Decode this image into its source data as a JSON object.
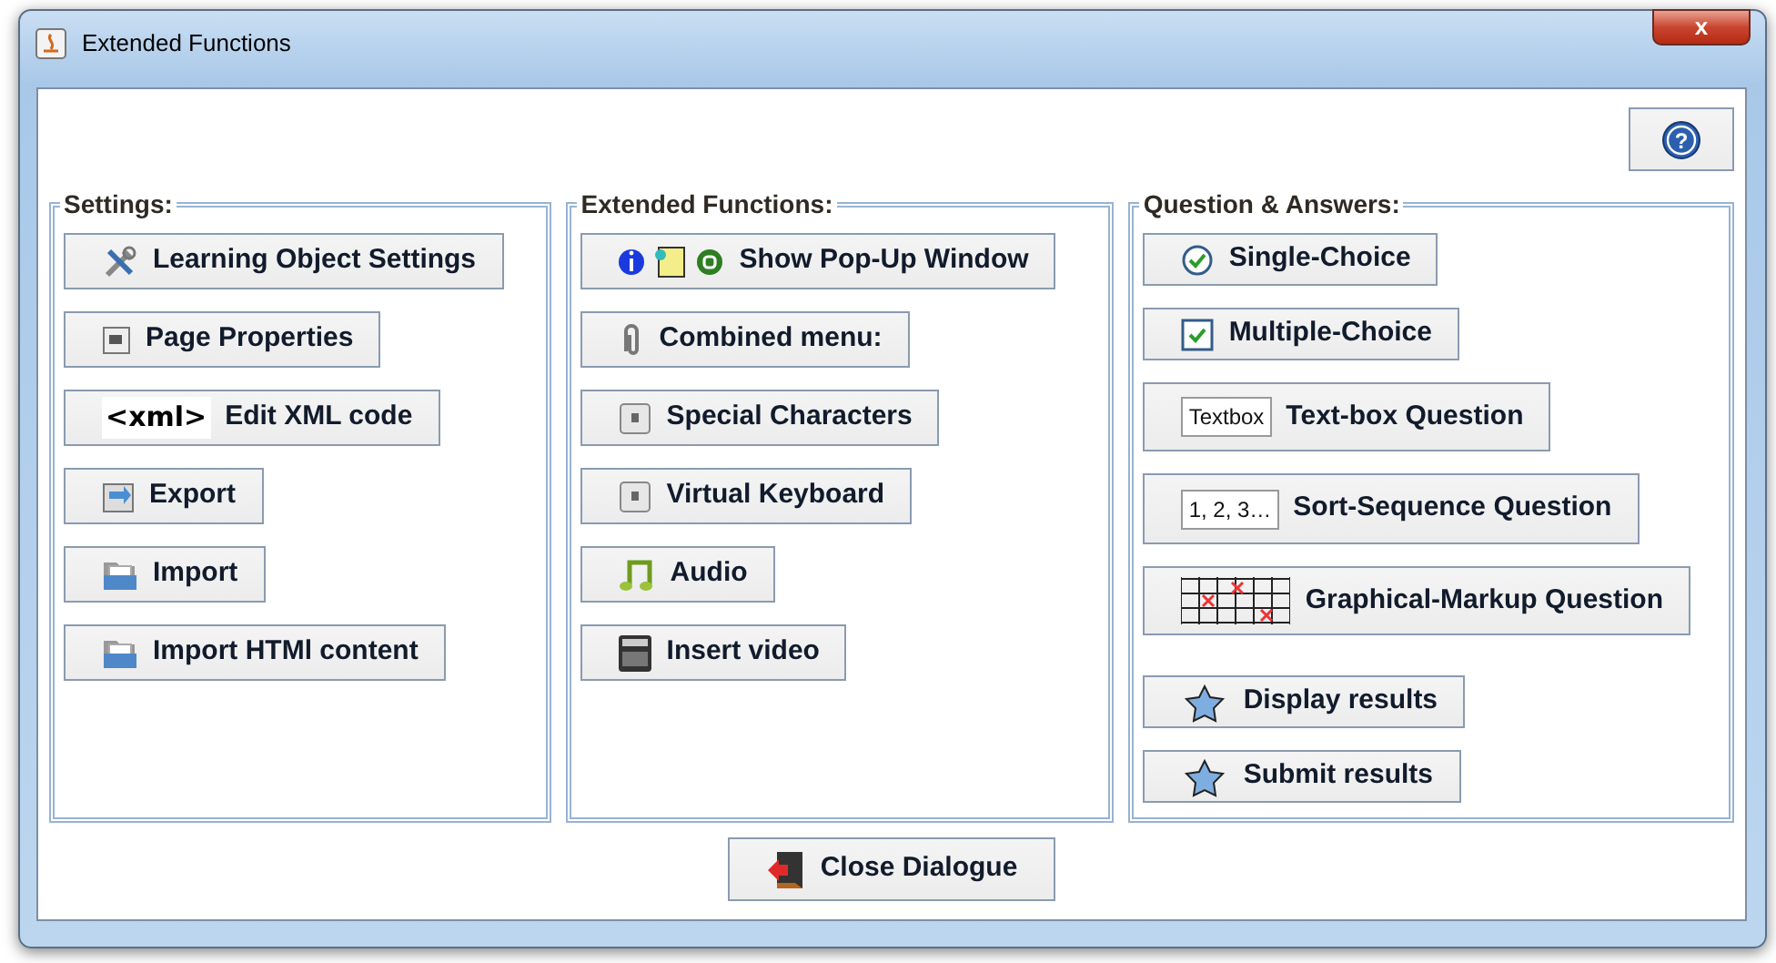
{
  "window": {
    "title": "Extended Functions",
    "close_label": "x"
  },
  "help_button": {
    "icon": "?"
  },
  "panels": [
    {
      "title": "Settings:",
      "buttons": [
        {
          "label": "Learning Object Settings",
          "kind": "tools"
        },
        {
          "label": "Page Properties",
          "kind": "page"
        },
        {
          "label": "Edit XML code",
          "kind": "xml",
          "icon_text": "<xml>"
        },
        {
          "label": "Export",
          "kind": "export"
        },
        {
          "label": "Import",
          "kind": "folder"
        },
        {
          "label": "Import HTMl content",
          "kind": "folder"
        }
      ]
    },
    {
      "title": "Extended Functions:",
      "buttons": [
        {
          "label": "Show Pop-Up Window",
          "kind": "popup"
        },
        {
          "label": "Combined menu:",
          "kind": "clip"
        },
        {
          "label": "Special Characters",
          "kind": "key"
        },
        {
          "label": "Virtual Keyboard",
          "kind": "key"
        },
        {
          "label": "Audio",
          "kind": "music"
        },
        {
          "label": "Insert video",
          "kind": "film"
        }
      ]
    },
    {
      "title": "Question & Answers:",
      "buttons": [
        {
          "label": "Single-Choice",
          "kind": "radio"
        },
        {
          "label": "Multiple-Choice",
          "kind": "check"
        },
        {
          "label": "Text-box Question",
          "kind": "textbox",
          "icon_text": "Textbox"
        },
        {
          "label": "Sort-Sequence Question",
          "kind": "textbox",
          "icon_text": "1, 2, 3…"
        },
        {
          "label": "Graphical-Markup Question",
          "kind": "grid"
        },
        {
          "label": "Display results",
          "kind": "star",
          "spaced": true
        },
        {
          "label": "Submit results",
          "kind": "star"
        }
      ]
    }
  ],
  "close_button": {
    "label": "Close Dialogue"
  }
}
